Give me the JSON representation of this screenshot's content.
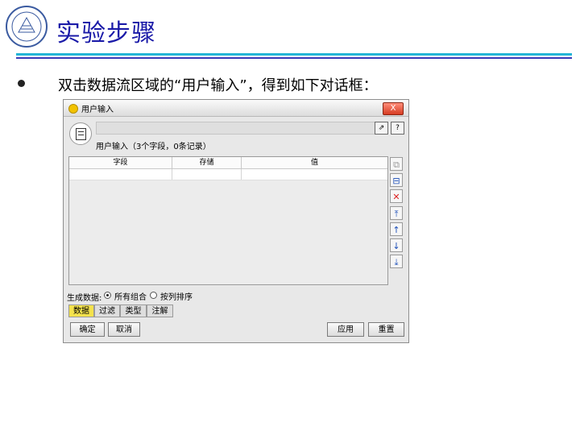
{
  "slide": {
    "title": "实验步骤",
    "bullet": "双击数据流区域的“用户输入”，得到如下对话框："
  },
  "dialog": {
    "title": "用户输入",
    "close_label": "X",
    "subtitle": "用户输入（3个字段，0条记录）",
    "columns": [
      "字段",
      "存储",
      "值"
    ],
    "generate_label": "生成数据:",
    "radio_options": [
      "所有组合",
      "按列排序"
    ],
    "selected_radio": "所有组合",
    "tabs": [
      "数据",
      "过滤",
      "类型",
      "注解"
    ],
    "active_tab": "数据",
    "buttons": {
      "ok": "确定",
      "cancel": "取消",
      "apply": "应用",
      "reset": "重置"
    }
  },
  "colors": {
    "title": "#1a1aa8",
    "rule_cyan": "#23b5d6",
    "rule_blue": "#3a3ab8",
    "active_tab": "#f4e24c"
  }
}
